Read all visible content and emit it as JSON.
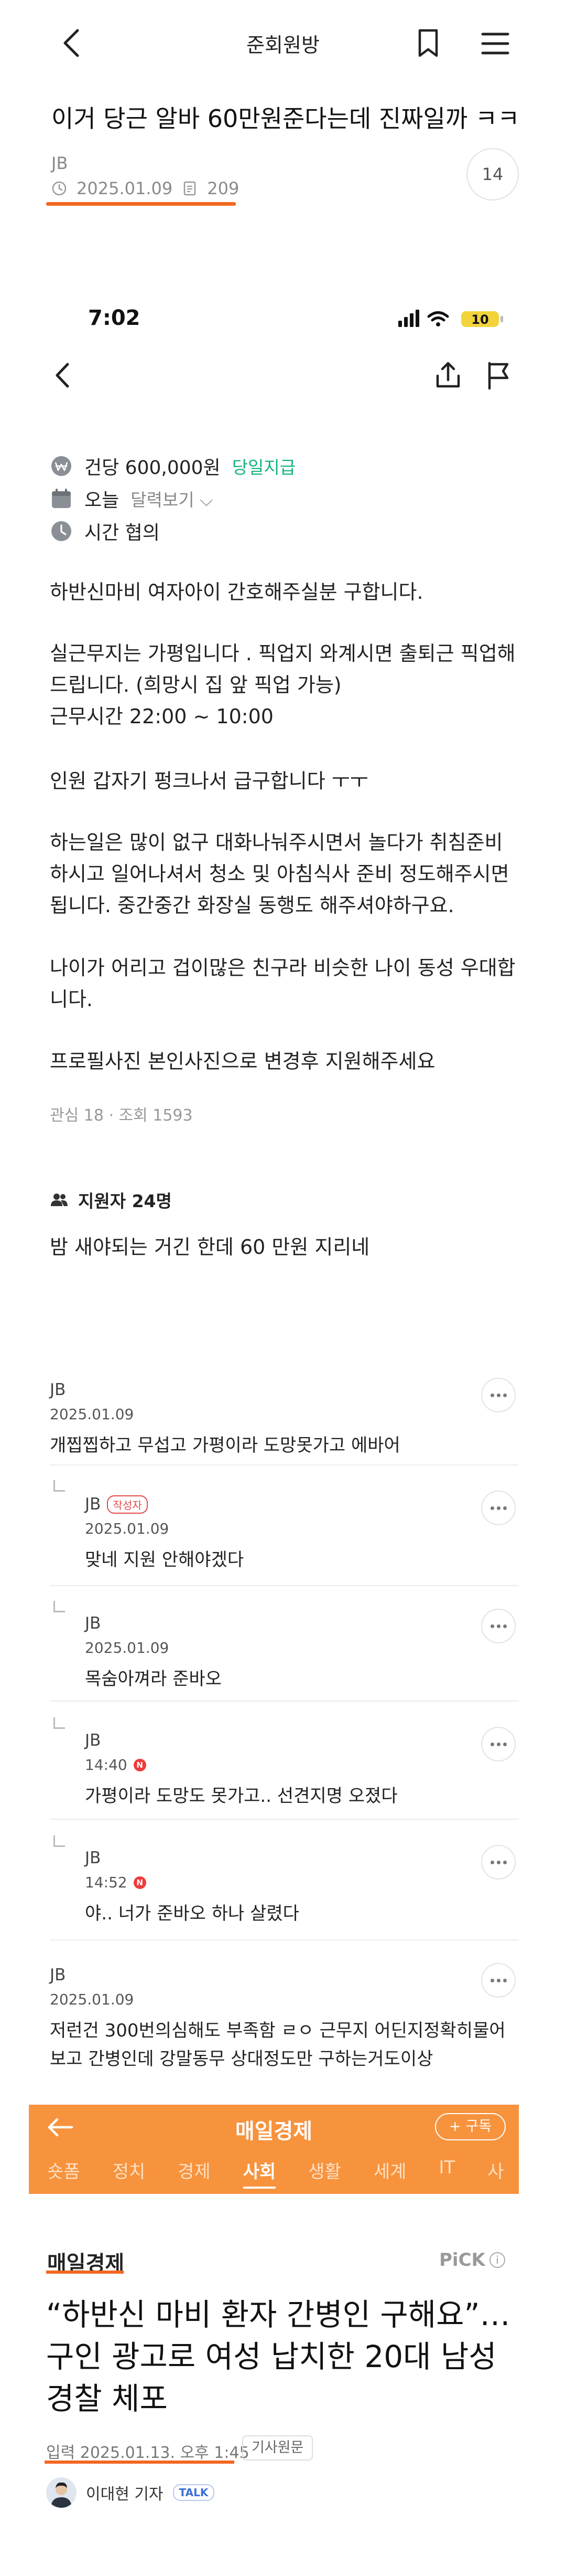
{
  "community": {
    "board_title": "준회원방",
    "post_title": "이거 당근 알바 60만원준다는데 진짜일까 ㅋㅋ",
    "author": "JB",
    "date": "2025.01.09",
    "views": "209",
    "comment_count": "14"
  },
  "status_bar": {
    "time": "7:02",
    "battery": "10"
  },
  "job_post": {
    "pay": "건당 600,000원",
    "pay_tag": "당일지급",
    "date_label": "오늘",
    "calendar_link": "달력보기",
    "time_label": "시간 협의",
    "paragraphs": [
      "하반신마비 여자아이 간호해주실분 구합니다.",
      "실근무지는 가평입니다 . 픽업지 와계시면 출퇴근 픽업해드립니다. (희망시 집 앞 픽업 가능)\n근무시간 22:00 ~ 10:00",
      "인원 갑자기 펑크나서 급구합니다 ㅜㅜ",
      "하는일은 많이 없구 대화나눠주시면서 놀다가 취침준비 하시고 일어나셔서 청소 및 아침식사 준비 정도해주시면됩니다. 중간중간 화장실 동행도 해주셔야하구요.",
      "나이가 어리고 겁이많은 친구라 비슷한 나이 동성 우대합니다.",
      "프로필사진 본인사진으로 변경후 지원해주세요"
    ],
    "stats": "관심 18 · 조회 1593",
    "applicants": "지원자 24명"
  },
  "post_comment": "밤 새야되는 거긴 한데 60 만원 지리네",
  "comments": [
    {
      "author": "JB",
      "date": "2025.01.09",
      "text": "개찝찝하고 무섭고 가평이라 도망못가고 에바어"
    },
    {
      "author": "JB",
      "badge": "작성자",
      "date": "2025.01.09",
      "text": "맞네 지원 안해야겠다"
    },
    {
      "author": "JB",
      "date": "2025.01.09",
      "text": "목숨아껴라 준바오"
    },
    {
      "author": "JB",
      "date": "14:40",
      "new": "N",
      "text": "가평이라 도망도 못가고.. 선견지명 오졌다"
    },
    {
      "author": "JB",
      "date": "14:52",
      "new": "N",
      "text": "야.. 너가 준바오 하나 살렸다"
    },
    {
      "author": "JB",
      "date": "2025.01.09",
      "text": "저런건 300번의심해도 부족함 ㄹㅇ 근무지 어딘지정확히물어보고 간병인데 강말동무 상대정도만 구하는거도이상"
    }
  ],
  "news": {
    "brand": "매일경제",
    "subscribe": "+ 구독",
    "tabs": [
      "숏폼",
      "정치",
      "경제",
      "사회",
      "생활",
      "세계",
      "IT",
      "사"
    ],
    "active_tab": "사회",
    "source": "매일경제",
    "pick": "PiCK",
    "headline": "“하반신 마비 환자 간병인 구해요”…구인 광고로 여성 납치한 20대 남성 경찰 체포",
    "date": "입력 2025.01.13. 오후 1:45",
    "original": "기사원문",
    "reporter": "이대현 기자",
    "talk": "TALK"
  },
  "colors": {
    "accent": "#f2671f",
    "news_orange": "#f7933d",
    "green": "#14b37d"
  }
}
